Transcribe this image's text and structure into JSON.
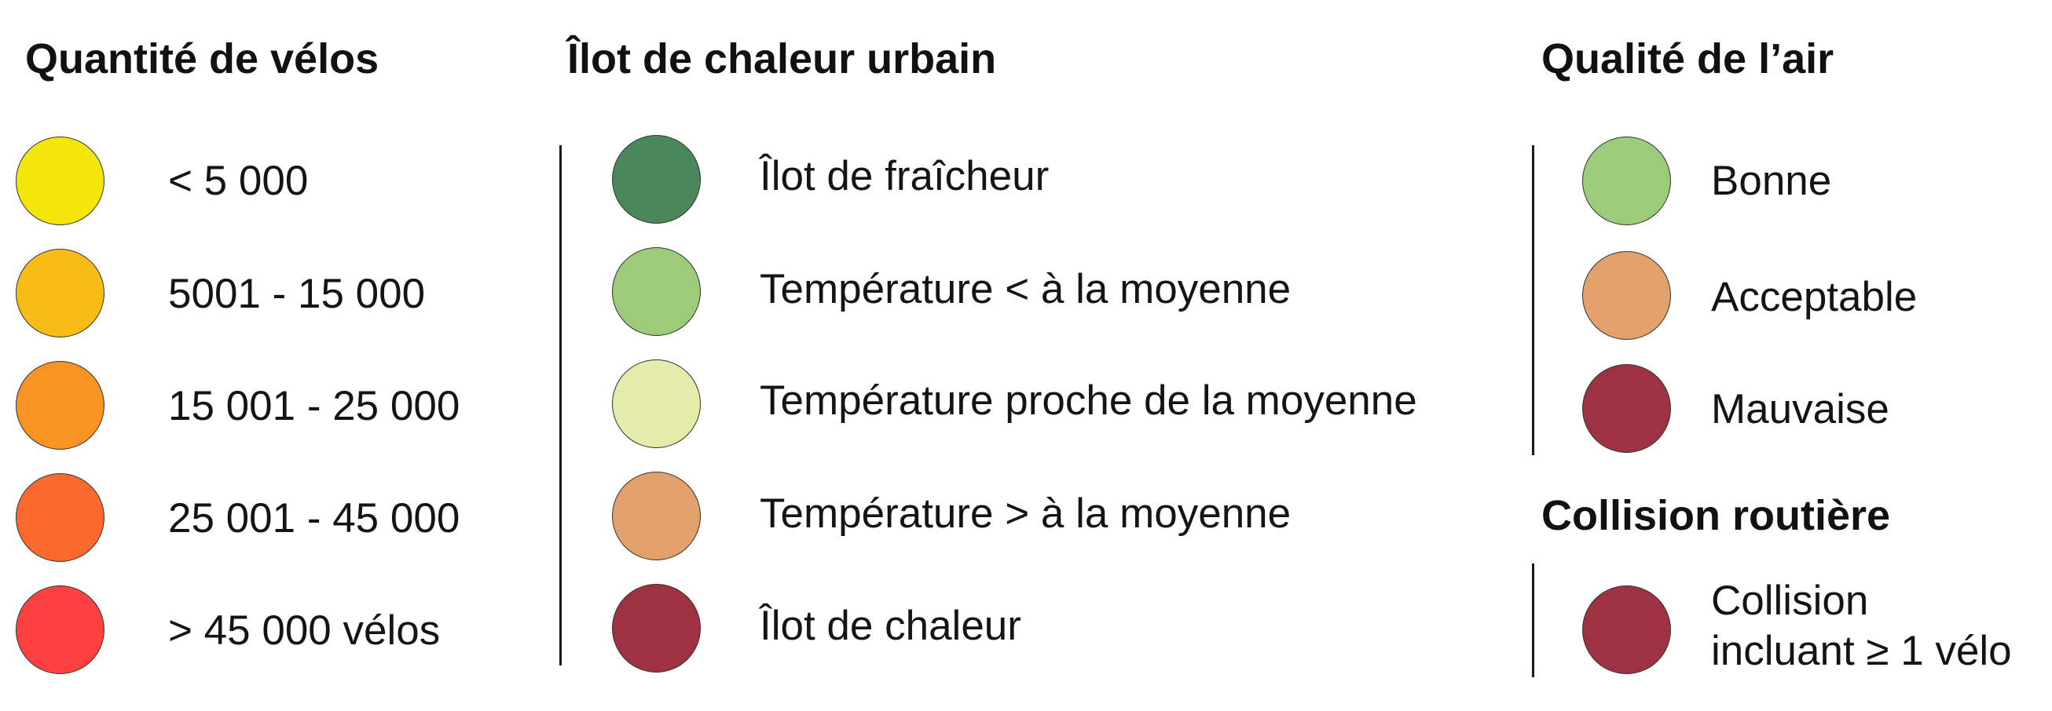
{
  "legends": {
    "velos": {
      "title": "Quantité de vélos",
      "items": [
        {
          "label": "< 5 000",
          "color": "#f5e60a"
        },
        {
          "label": "5001 - 15 000",
          "color": "#f7bd16"
        },
        {
          "label": "15 001 - 25 000",
          "color": "#f99323"
        },
        {
          "label": "25 001 - 45 000",
          "color": "#fb692e"
        },
        {
          "label": "> 45 000 vélos",
          "color": "#fd4140"
        }
      ]
    },
    "chaleur": {
      "title": "Îlot de chaleur urbain",
      "items": [
        {
          "label": "Îlot de fraîcheur",
          "color": "#4a875a"
        },
        {
          "label": "Température < à la moyenne",
          "color": "#9ccc79"
        },
        {
          "label": "Température proche de la moyenne",
          "color": "#e5eba8"
        },
        {
          "label": "Température > à la moyenne",
          "color": "#e2a06b"
        },
        {
          "label": "Îlot de chaleur",
          "color": "#9e3242"
        }
      ]
    },
    "air": {
      "title": "Qualité de l’air",
      "items": [
        {
          "label": "Bonne",
          "color": "#9ccc79"
        },
        {
          "label": "Acceptable",
          "color": "#e2a06b"
        },
        {
          "label": "Mauvaise",
          "color": "#9e3242"
        }
      ]
    },
    "collision": {
      "title": "Collision routière",
      "items": [
        {
          "label_line1": "Collision",
          "label_line2": "incluant ≥ 1 vélo",
          "color": "#9e3242"
        }
      ]
    }
  }
}
